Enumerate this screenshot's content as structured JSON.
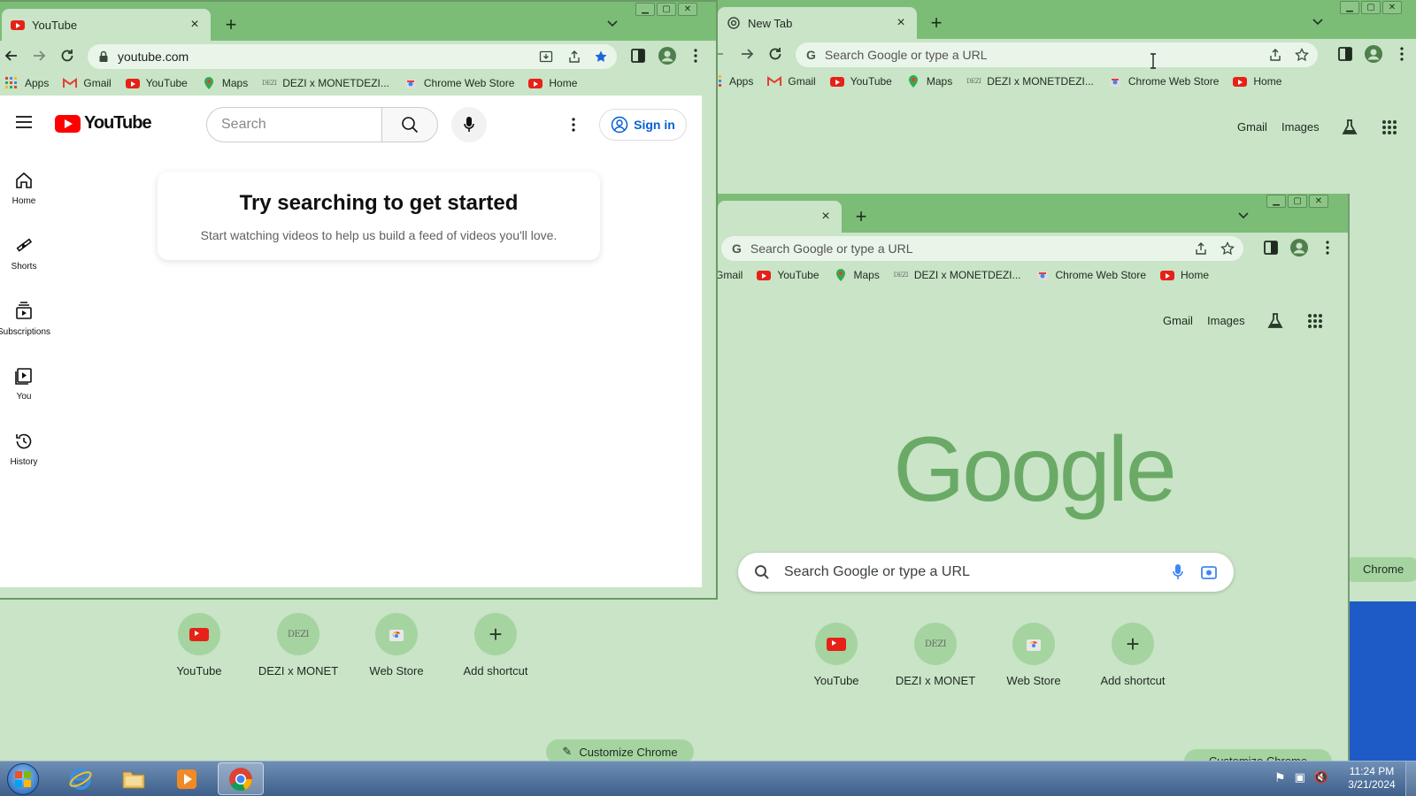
{
  "left_window": {
    "tab_title": "YouTube",
    "url": "youtube.com",
    "bookmarks": [
      "Apps",
      "Gmail",
      "YouTube",
      "Maps",
      "DEZI x MONETDEZI...",
      "Chrome Web Store",
      "Home"
    ]
  },
  "youtube": {
    "logo_text": "YouTube",
    "search_placeholder": "Search",
    "sign_in": "Sign in",
    "nav": [
      "Home",
      "Shorts",
      "Subscriptions",
      "You",
      "History"
    ],
    "card_title": "Try searching to get started",
    "card_body": "Start watching videos to help us build a feed of videos you'll love."
  },
  "behind_left": {
    "shortcuts": [
      "YouTube",
      "DEZI x MONET",
      "Web Store",
      "Add shortcut"
    ],
    "customize": "Customize Chrome"
  },
  "right_window": {
    "tab_title": "New Tab",
    "omnibox_placeholder": "Search Google or type a URL",
    "bookmarks": [
      "Apps",
      "Gmail",
      "YouTube",
      "Maps",
      "DEZI x MONETDEZI...",
      "Chrome Web Store",
      "Home"
    ],
    "links": [
      "Gmail",
      "Images"
    ]
  },
  "inner_window": {
    "omnibox_placeholder": "Search Google or type a URL",
    "bookmarks": [
      "Gmail",
      "YouTube",
      "Maps",
      "DEZI x MONETDEZI...",
      "Chrome Web Store",
      "Home"
    ],
    "links": [
      "Gmail",
      "Images"
    ],
    "logo": "Google",
    "search_placeholder": "Search Google or type a URL",
    "shortcuts": [
      "YouTube",
      "DEZI x MONET",
      "Web Store",
      "Add shortcut"
    ],
    "customize_partial": "Customize Chrome"
  },
  "right_edge_button": "Chrome",
  "taskbar": {
    "time": "11:24 PM",
    "date": "3/21/2024"
  },
  "colors": {
    "chrome_frame": "#7bbd76",
    "ntp_bg": "#c9e4c7",
    "youtube_red": "#ff0000",
    "google_logo": "#6aaa66",
    "desktop_blue": "#1e5bc6"
  }
}
